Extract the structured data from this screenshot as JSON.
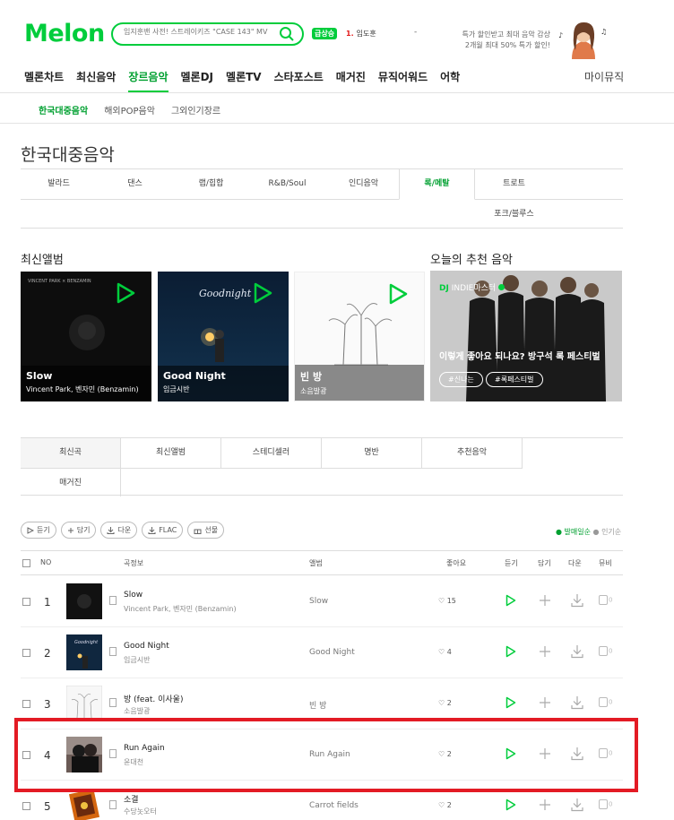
{
  "header": {
    "logo": "Melon",
    "search_placeholder": "임지훈밴 사전! 스트레이키즈 \"CASE 143\" MV",
    "rise_badge": "급상승",
    "rank_num": "1.",
    "rank_text": "임도훈",
    "dash": "-",
    "promo_line1": "특가 할인받고 최대 음악 감상",
    "promo_line2": "2개월 최대 50% 특가 할인!"
  },
  "gnb": {
    "items": [
      "멜론차트",
      "최신음악",
      "장르음악",
      "멜론DJ",
      "멜론TV",
      "스타포스트",
      "매거진",
      "뮤직어워드",
      "어학"
    ],
    "mymusic": "마이뮤직"
  },
  "subnav": [
    "한국대중음악",
    "해외POP음악",
    "그외인기장르"
  ],
  "page_title": "한국대중음악",
  "genres": [
    "발라드",
    "댄스",
    "랩/힙합",
    "R&B/Soul",
    "인디음악",
    "록/메탈",
    "트로트",
    "포크/블루스"
  ],
  "latest_album_title": "최신앨범",
  "recommend_title": "오늘의 추천 음악",
  "albums": [
    {
      "title": "Slow",
      "artist": "Vincent Park, 벤자민 (Benzamin)",
      "cover_text": "VINCENT PARK × BENZAMIN"
    },
    {
      "title": "Good Night",
      "artist": "임금시반",
      "cover_text": "Goodnight"
    },
    {
      "title": "빈 방",
      "artist": "소음발광",
      "cover_text": ""
    }
  ],
  "recommend": {
    "dj_label": "DJ",
    "dj_name": "INDIE마스터",
    "text": "이렇게 좋아요 되나요? 방구석 록 페스티벌",
    "tag1": "#신나는",
    "tag2": "#록페스티벌"
  },
  "tabs": [
    "최신곡",
    "최신앨범",
    "스테디셀러",
    "명반",
    "추천음악",
    "매거진"
  ],
  "tools": [
    {
      "icon": "play-icon",
      "label": "듣기"
    },
    {
      "icon": "plus-icon",
      "label": "담기"
    },
    {
      "icon": "download-icon",
      "label": "다운"
    },
    {
      "icon": "download-icon",
      "label": "FLAC"
    },
    {
      "icon": "gift-icon",
      "label": "선물"
    }
  ],
  "sort": {
    "on": "발매일순",
    "off": "인기순"
  },
  "list_head": {
    "no": "NO",
    "song": "곡정보",
    "album": "앨범",
    "like": "좋아요",
    "play": "듣기",
    "add": "담기",
    "down": "다운",
    "mv": "뮤비"
  },
  "rows": [
    {
      "no": "1",
      "title": "Slow",
      "artist": "Vincent Park, 벤자민 (Benzamin)",
      "album": "Slow",
      "likes": "15",
      "mv": "0"
    },
    {
      "no": "2",
      "title": "Good Night",
      "artist": "임금시반",
      "album": "Good Night",
      "likes": "4",
      "mv": "0"
    },
    {
      "no": "3",
      "title": "방 (feat. 이사울)",
      "artist": "소음발광",
      "album": "빈 방",
      "likes": "2",
      "mv": "0"
    },
    {
      "no": "4",
      "title": "Run Again",
      "artist": "윤대천",
      "album": "Run Again",
      "likes": "2",
      "mv": "0"
    },
    {
      "no": "5",
      "title": "소결",
      "artist": "수당놋오터",
      "album": "Carrot fields",
      "likes": "2",
      "mv": "0"
    }
  ],
  "colors": {
    "brand": "#00cd3c",
    "highlight": "#e31b24"
  }
}
